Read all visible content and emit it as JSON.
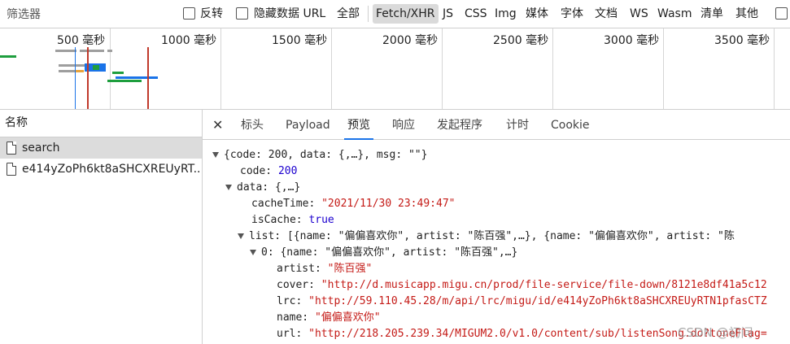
{
  "toolbar": {
    "filter_placeholder": "筛选器",
    "invert_label": "反转",
    "hide_data_url_label": "隐藏数据 URL",
    "type_filters": [
      "全部",
      "Fetch/XHR",
      "JS",
      "CSS",
      "Img",
      "媒体",
      "字体",
      "文档",
      "WS",
      "Wasm",
      "清单",
      "其他"
    ],
    "active_type": "Fetch/XHR"
  },
  "timeline": {
    "ticks": [
      "500 毫秒",
      "1000 毫秒",
      "1500 毫秒",
      "2000 毫秒",
      "2500 毫秒",
      "3000 毫秒",
      "3500 毫秒"
    ]
  },
  "request_list": {
    "column_name": "名称",
    "rows": [
      {
        "name": "search",
        "selected": true
      },
      {
        "name": "e414yZoPh6kt8aSHCXREUyRT...",
        "selected": false
      }
    ]
  },
  "detail": {
    "tabs": [
      "标头",
      "Payload",
      "预览",
      "响应",
      "发起程序",
      "计时",
      "Cookie"
    ],
    "active_tab": "预览",
    "preview": {
      "root_summary": "{code: 200, data: {,…}, msg: \"\"}",
      "code_key": "code:",
      "code_val": "200",
      "data_key": "data:",
      "data_summary": "{,…}",
      "cacheTime_key": "cacheTime:",
      "cacheTime_val": "\"2021/11/30 23:49:47\"",
      "isCache_key": "isCache:",
      "isCache_val": "true",
      "list_key": "list:",
      "list_summary": "[{name: \"偏偏喜欢你\", artist: \"陈百强\",…}, {name: \"偏偏喜欢你\", artist: \"陈",
      "item0_key": "0:",
      "item0_summary": "{name: \"偏偏喜欢你\", artist: \"陈百强\",…}",
      "artist_key": "artist:",
      "artist_val": "\"陈百强\"",
      "cover_key": "cover:",
      "cover_val": "\"http://d.musicapp.migu.cn/prod/file-service/file-down/8121e8df41a5c12",
      "lrc_key": "lrc:",
      "lrc_val": "\"http://59.110.45.28/m/api/lrc/migu/id/e414yZoPh6kt8aSHCXREUyRTN1pfasCTZ",
      "name_key": "name:",
      "name_val": "\"偏偏喜欢你\"",
      "url_key": "url:",
      "url_val": "\"http://218.205.239.34/MIGUM2.0/v1.0/content/sub/listenSong.do?toneFlag="
    }
  },
  "watermark": "CSDN @初问",
  "colors": {
    "accent": "#1a73e8",
    "string": "#c41a16",
    "number": "#1c00cf"
  }
}
